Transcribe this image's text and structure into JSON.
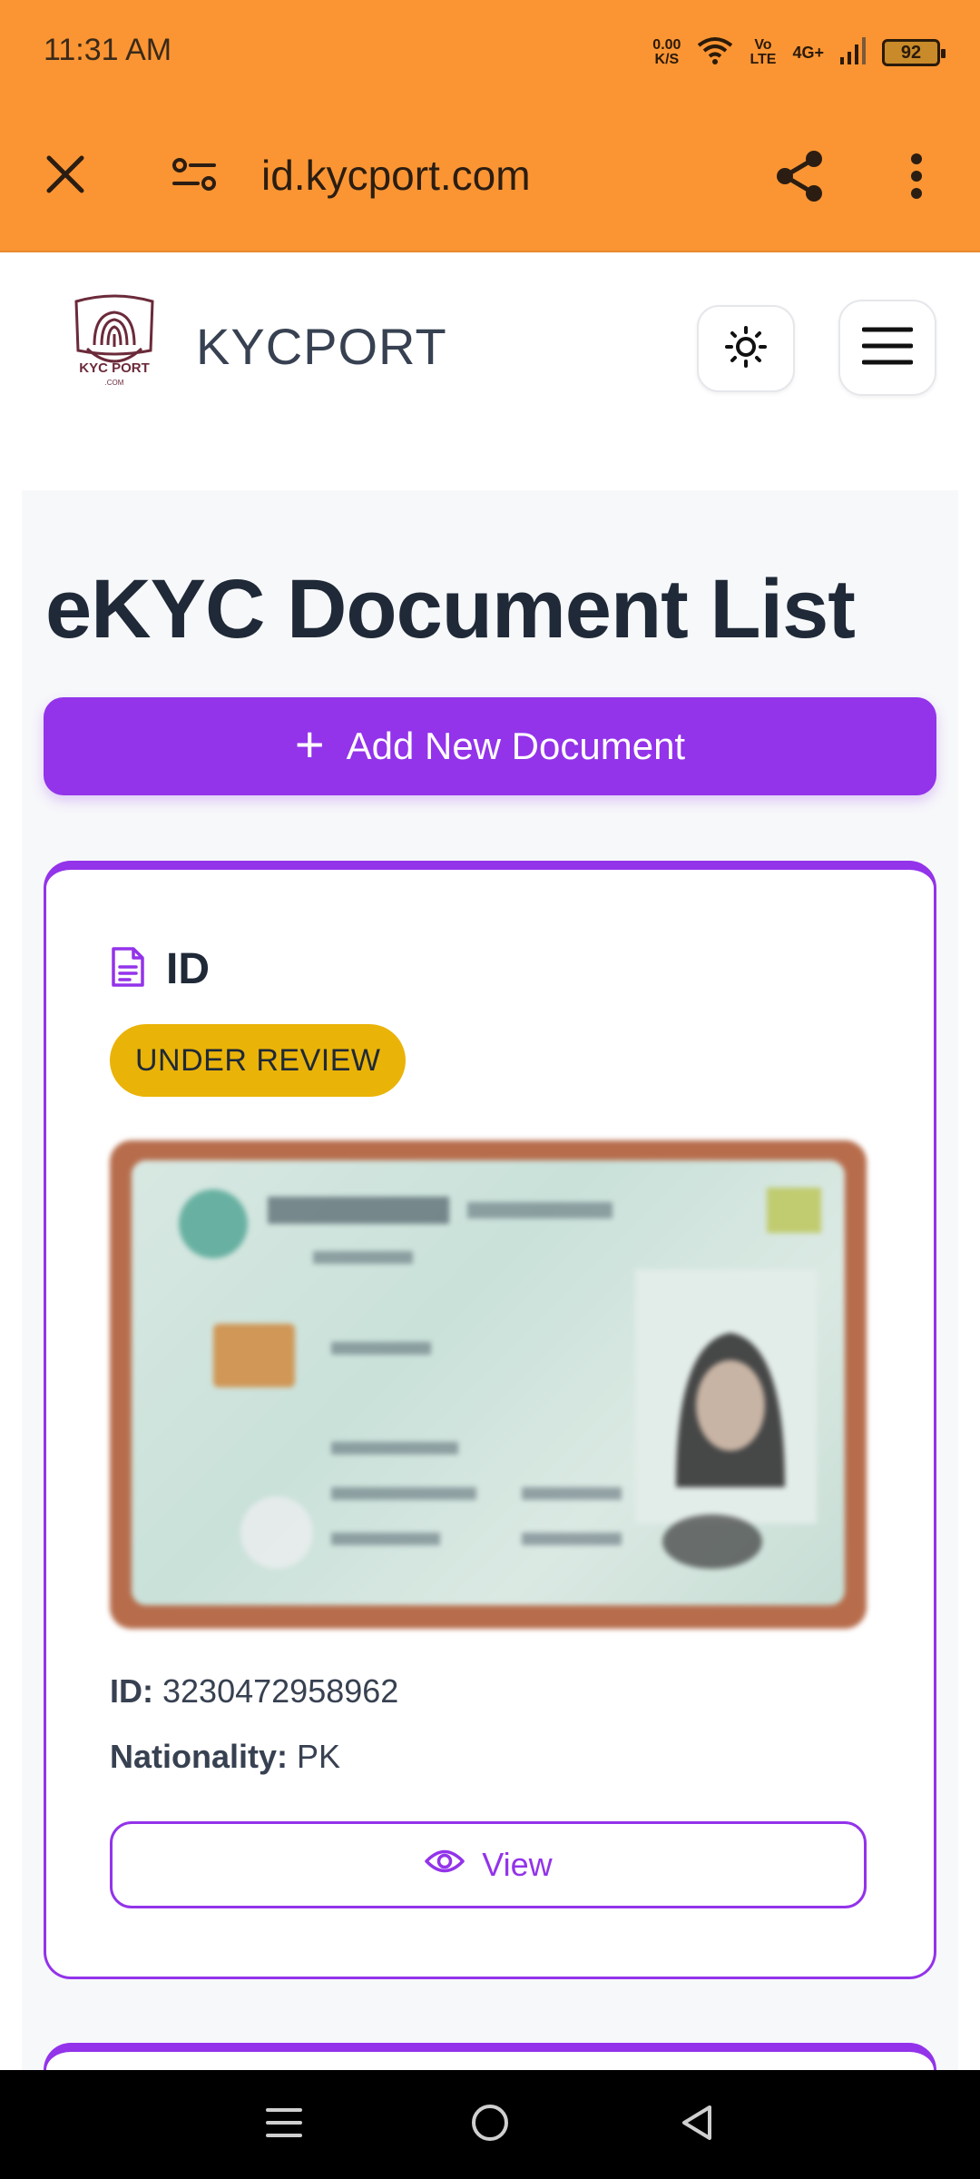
{
  "status_bar": {
    "time": "11:31 AM",
    "net_speed_value": "0.00",
    "net_speed_unit": "K/S",
    "volte_line1": "Vo",
    "volte_line2": "LTE",
    "network": "4G+",
    "battery": "92"
  },
  "browser": {
    "url": "id.kycport.com",
    "icons": [
      "close-icon",
      "site-settings-icon",
      "share-icon",
      "more-vert-icon"
    ]
  },
  "header": {
    "logo_text": "KYC PORT",
    "logo_subtext": ".COM",
    "brand": "KYCPORT",
    "icons": [
      "sun-icon",
      "hamburger-menu-icon"
    ]
  },
  "main": {
    "title": "eKYC Document List",
    "add_button_icon": "+",
    "add_button_label": "Add New Document",
    "documents": [
      {
        "type": "ID",
        "status": "UNDER REVIEW",
        "id_label": "ID:",
        "id_value": "3230472958962",
        "nationality_label": "Nationality:",
        "nationality_value": "PK",
        "view_label": "View"
      }
    ]
  },
  "colors": {
    "browser_bar": "#FB9533",
    "accent": "#9333EA",
    "badge_under_review": "#EAB308",
    "title": "#1f2937",
    "panel_bg": "#f7f8fa"
  }
}
